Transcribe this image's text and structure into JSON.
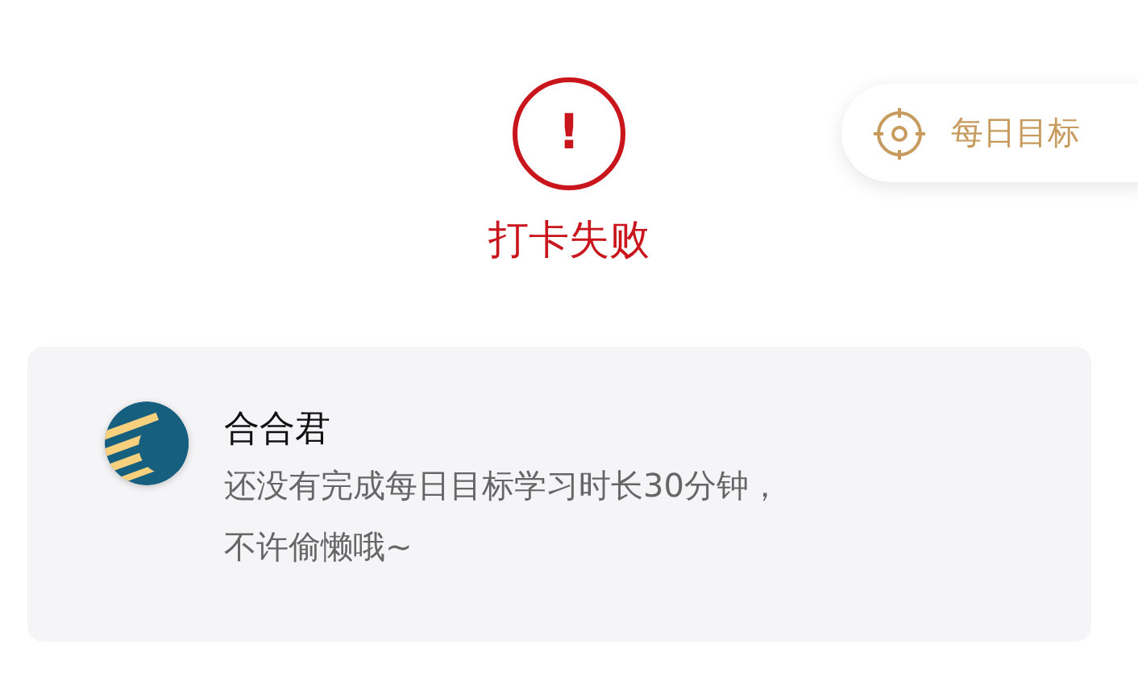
{
  "status": {
    "kind": "failure",
    "mark": "!",
    "title": "打卡失败"
  },
  "goal_button": {
    "label": "每日目标"
  },
  "message": {
    "sender": "合合君",
    "lines": [
      "还没有完成每日目标学习时长30分钟，",
      "不许偷懒哦~"
    ]
  }
}
